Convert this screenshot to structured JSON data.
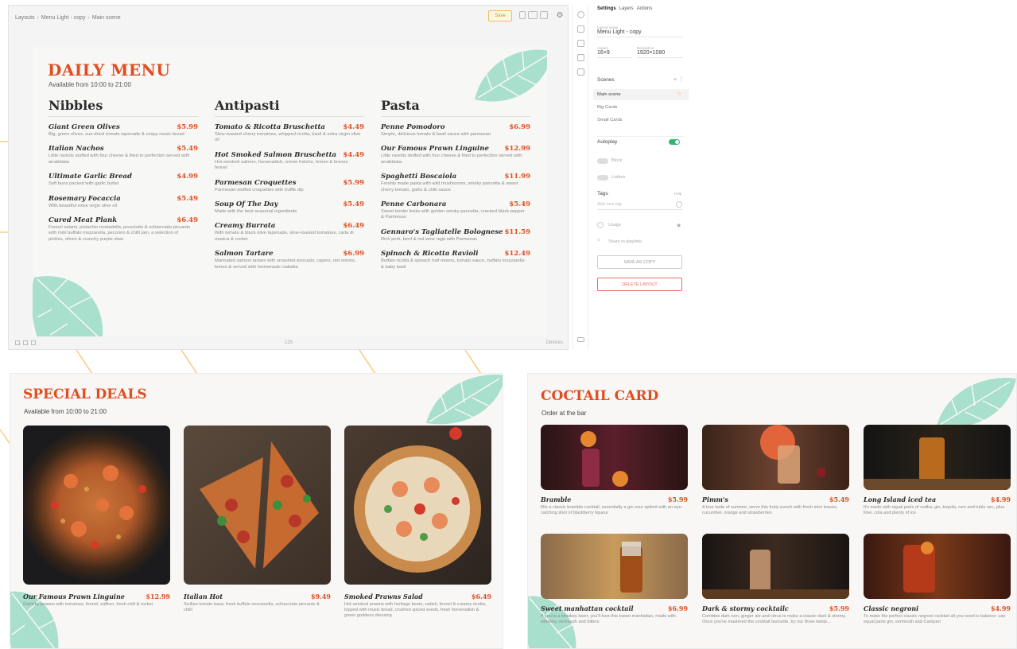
{
  "editor": {
    "breadcrumb": [
      "Layouts",
      "Menu Light - copy",
      "Main scene"
    ],
    "save_label": "Save",
    "zoom": "125",
    "footer_right": "Devices"
  },
  "daily_menu": {
    "title": "DAILY MENU",
    "subtitle": "Available from 10:00 to 21:00",
    "columns": [
      {
        "heading": "Nibbles",
        "items": [
          {
            "name": "Giant Green Olives",
            "price": "$5.99",
            "desc": "Big, green olives, sun-dried tomato tapenade & crispy music bread"
          },
          {
            "name": "Italian Nachos",
            "price": "$5.49",
            "desc": "Little raviolis stuffed with four cheese & fried to perfection served with arrabbiata"
          },
          {
            "name": "Ultimate Garlic Bread",
            "price": "$4.99",
            "desc": "Soft buns packed with garlic butter"
          },
          {
            "name": "Rosemary Focaccia",
            "price": "$5.49",
            "desc": "With beautiful extra virgin olive oil"
          },
          {
            "name": "Cured Meat Plank",
            "price": "$6.49",
            "desc": "Fennel salami, pistachio mortadella, prosciutto & schiacciata piccante with mini buffalo mozzarella, pecorino & chilli jam, a selection of pickles, olives & crunchy purple slaw"
          }
        ]
      },
      {
        "heading": "Antipasti",
        "items": [
          {
            "name": "Tomato & Ricotta Bruschetta",
            "price": "$4.49",
            "desc": "Slow-roasted cherry tomatoes, whipped ricotta, basil & extra virgin olive oil"
          },
          {
            "name": "Hot Smoked Salmon Bruschetta",
            "price": "$4.49",
            "desc": "Hot-smoked salmon, horseradish, crème fraîche, lemon & bronze fennel"
          },
          {
            "name": "Parmesan Croquettes",
            "price": "$5.99",
            "desc": "Parmesan-stuffed croquettes with truffle dip"
          },
          {
            "name": "Soup Of The Day",
            "price": "$5.49",
            "desc": "Made with the best seasonal ingredients"
          },
          {
            "name": "Creamy Burrata",
            "price": "$6.49",
            "desc": "With tomato & black olive tapenade, slow-roasted tomatoes, carta di musica & rocket"
          },
          {
            "name": "Salmon Tartare",
            "price": "$6.99",
            "desc": "Marinated salmon tartare with smashed avocado, capers, red onions, lemon & served with homemade ciabatta"
          }
        ]
      },
      {
        "heading": "Pasta",
        "items": [
          {
            "name": "Penne Pomodoro",
            "price": "$6.99",
            "desc": "Simple, delicious tomato & basil sauce with parmesan"
          },
          {
            "name": "Our Famous Prawn Linguine",
            "price": "$12.99",
            "desc": "Little raviolis stuffed with four cheese & fried to perfection served with arrabbiata"
          },
          {
            "name": "Spaghetti Boscaiola",
            "price": "$11.99",
            "desc": "Freshly made pasta with wild mushrooms, smoky pancetta & sweet cherry tomato, garlic & chilli sauce"
          },
          {
            "name": "Penne Carbonara",
            "price": "$5.49",
            "desc": "Sweet tender leeks with golden smoky pancetta, cracked black pepper & Parmesan"
          },
          {
            "name": "Gennaro's Tagliatelle Bolognese",
            "price": "$11.59",
            "desc": "Rich pork, beef & red wine ragù with Parmesan"
          },
          {
            "name": "Spinach & Ricotta Ravioli",
            "price": "$12.49",
            "desc": "Buffalo ricotta & spinach half moons, tomato sauce, buffalo mozzarella & baby basil"
          }
        ]
      }
    ]
  },
  "panel": {
    "tabs": [
      "Settings",
      "Layers",
      "Actions"
    ],
    "layout_name_label": "Layout name",
    "layout_name": "Menu Light - copy",
    "aspect_label": "Aspect",
    "aspect": "16×9",
    "resolution_label": "Resolution",
    "resolution": "1920×1080",
    "scenes_label": "Scenes",
    "scenes": [
      "Main scene",
      "Big Cards",
      "Small Cards"
    ],
    "autoplay_label": "Autoplay",
    "block_label": "Block",
    "listbox_label": "Listbox",
    "tags_label": "Tags",
    "tags_help": "Help",
    "tags_placeholder": "Add new tag",
    "usage_label": "Usage",
    "share_label": "Share to playlists",
    "save_copy_label": "SAVE AS COPY",
    "delete_label": "DELETE LAYOUT"
  },
  "special_deals": {
    "title": "SPECIAL DEALS",
    "subtitle": "Available from 10:00 to 21:00",
    "items": [
      {
        "name": "Our Famous Prawn Linguine",
        "price": "$12.99",
        "desc": "Garlicky prawns with tomatoes, fennel, saffron, fresh chili & rocket"
      },
      {
        "name": "Italian Hot",
        "price": "$9.49",
        "desc": "Sicilian tomato base, fresh buffalo mozzarella, schiacciata piccante & chilli"
      },
      {
        "name": "Smoked Prawns Salad",
        "price": "$6.49",
        "desc": "Hot-smoked prawns with heritage beets, radish, fennel & creamy ricotta, topped with music bread, crushed spiced seeds, fresh horseradish & green goddess dressing"
      }
    ]
  },
  "coctail_card": {
    "title": "COCTAIL CARD",
    "subtitle": "Order at the bar",
    "items": [
      {
        "name": "Bramble",
        "price": "$5.99",
        "desc": "Mix a classic bramble cocktail, essentially a gin sour spiked with an eye-catching shot of blackberry liqueur"
      },
      {
        "name": "Pimm's",
        "price": "$5.49",
        "desc": "A true taste of summer, serve this fruity punch with fresh mint leaves, cucumber, orange and strawberries"
      },
      {
        "name": "Long Island iced tea",
        "price": "$4.99",
        "desc": "It's made with equal parts of vodka, gin, tequila, rum and triple sec, plus lime, cola and plenty of ice"
      },
      {
        "name": "Sweet manhattan cocktail",
        "price": "$6.99",
        "desc": "If you're a whiskey lover, you'll love this sweet manhattan, made with whiskey, vermouth and bitters"
      },
      {
        "name": "Dark & stormy cocktailc",
        "price": "$5.99",
        "desc": "Combine dark rum, ginger ale and citrus to make a classic dark & stormy. Once you've mastered the cocktail favourite, try our three twists..."
      },
      {
        "name": "Classic negroni",
        "price": "$4.99",
        "desc": "To make the perfect classic negroni cocktail all you need is balance: use equal parts gin, vermouth and Campari"
      }
    ]
  },
  "colors": {
    "accent": "#e24d1f",
    "leaf": "#a9dfcd",
    "connector": "#f3c16a"
  }
}
